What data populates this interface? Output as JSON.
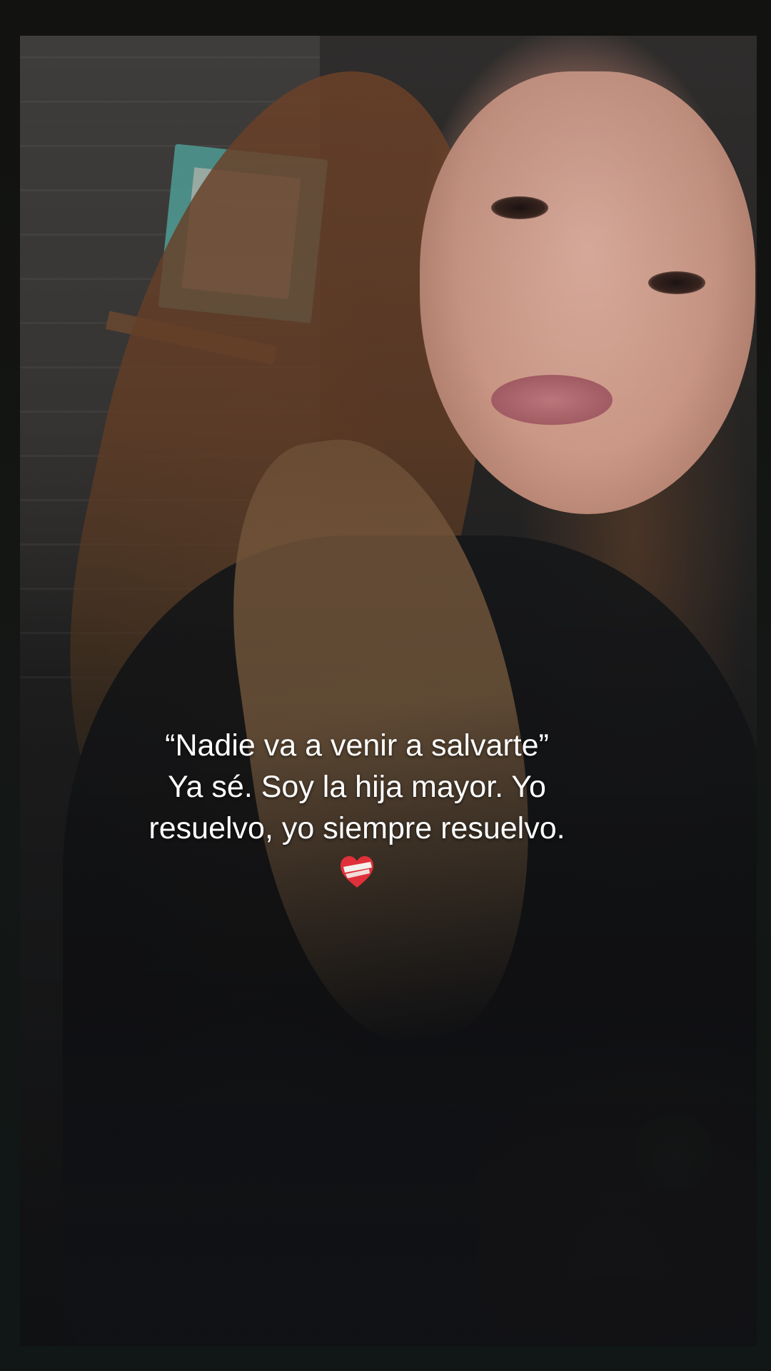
{
  "caption": {
    "line1": "“Nadie va a venir a salvarte”",
    "line2": "Ya sé. Soy la hija mayor. Yo",
    "line3": "resuelvo, yo siempre resuelvo.",
    "emoji": "mending-heart-icon"
  },
  "colors": {
    "frame_background": "#121210",
    "caption_text": "#ffffff",
    "heart_red": "#e0303a"
  }
}
